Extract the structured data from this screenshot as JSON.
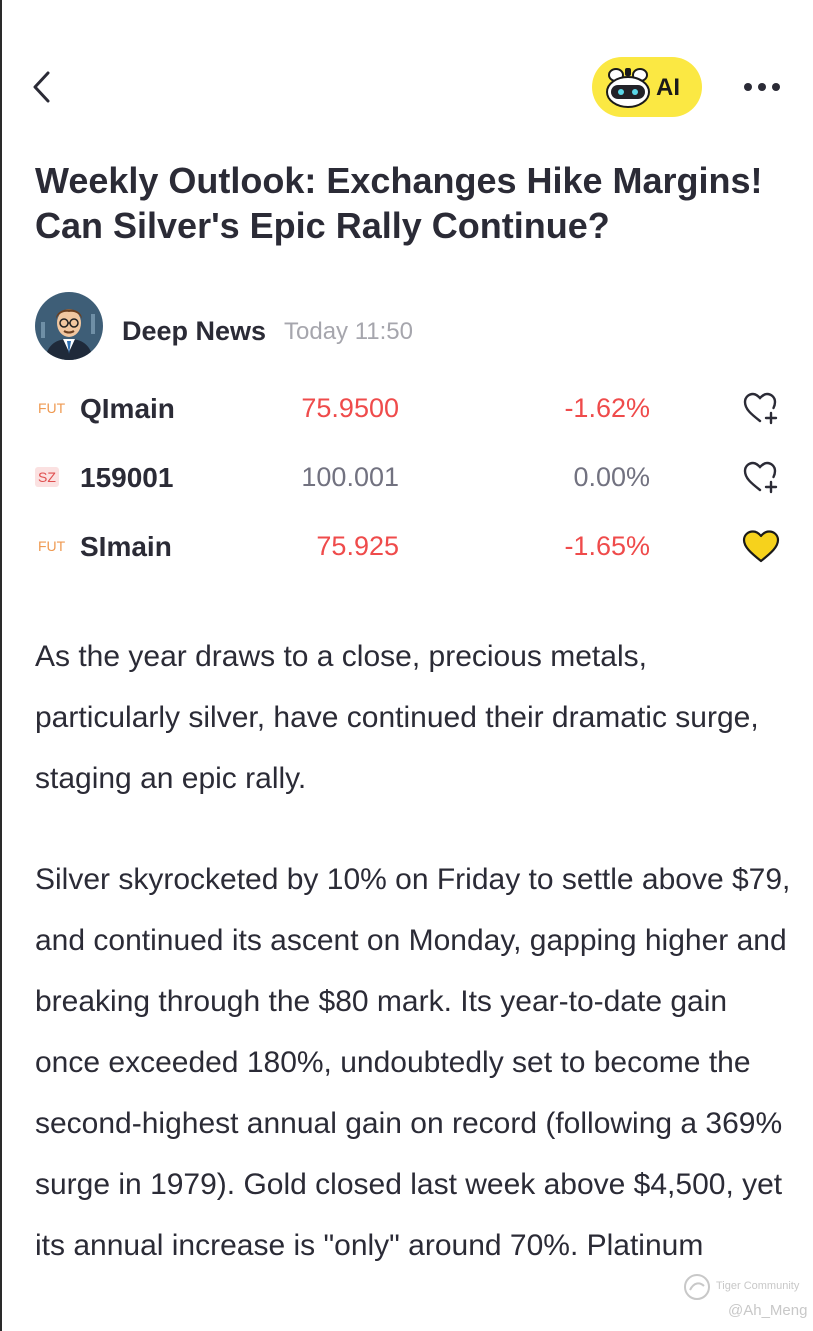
{
  "header": {
    "ai_label": "AI",
    "icons": [
      "back-chevron-icon",
      "ai-robot-icon",
      "more-dots-icon"
    ]
  },
  "article": {
    "title": "Weekly Outlook: Exchanges Hike Margins! Can Silver's Epic Rally Continue?",
    "author": "Deep News",
    "time": "Today 11:50",
    "paragraphs": [
      "As the year draws to a close, precious metals, particularly silver, have continued their dramatic surge, staging an epic rally.",
      "Silver skyrocketed by 10% on Friday to settle above $79, and continued its ascent on Monday, gapping higher and breaking through the $80 mark. Its year-to-date gain once exceeded 180%, undoubtedly set to become the second-highest annual gain on record (following a 369% surge in 1979). Gold closed last week above $4,500, yet its annual increase is \"only\" around 70%. Platinum"
    ]
  },
  "quotes": [
    {
      "market": "FUT",
      "symbol": "QImain",
      "price": "75.9500",
      "change": "-1.62%",
      "direction": "down",
      "watchlisted": false
    },
    {
      "market": "SZ",
      "symbol": "159001",
      "price": "100.001",
      "change": "0.00%",
      "direction": "flat",
      "watchlisted": false
    },
    {
      "market": "FUT",
      "symbol": "SImain",
      "price": "75.925",
      "change": "-1.65%",
      "direction": "down",
      "watchlisted": true
    }
  ],
  "watermark": {
    "brand": "Tiger Community",
    "user": "@Ah_Meng"
  },
  "colors": {
    "ai_button": "#fbe843",
    "down": "#ef4b4b",
    "flat": "#727280",
    "heart_filled": "#f6d21c",
    "text": "#2b2b36",
    "muted": "#a6a6ad"
  }
}
